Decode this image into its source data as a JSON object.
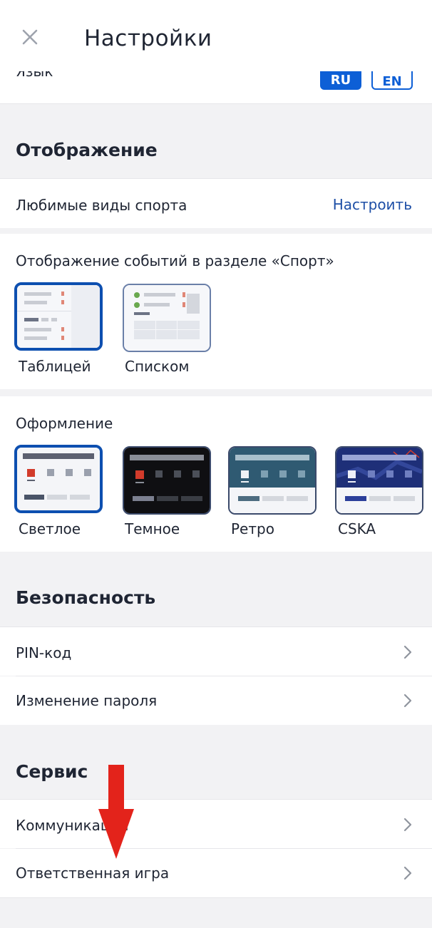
{
  "header": {
    "title": "Настройки"
  },
  "language": {
    "label": "Язык",
    "ru": "RU",
    "en": "EN"
  },
  "display": {
    "heading": "Отображение",
    "favorite_sports": {
      "label": "Любимые виды спорта",
      "action": "Настроить"
    },
    "events_view": {
      "label": "Отображение событий в разделе «Спорт»",
      "options": [
        "Таблицей",
        "Списком"
      ],
      "selected": "Таблицей"
    },
    "theme": {
      "label": "Оформление",
      "options": [
        "Светлое",
        "Темное",
        "Ретро",
        "CSKA"
      ],
      "selected": "Светлое"
    }
  },
  "security": {
    "heading": "Безопасность",
    "items": [
      "PIN-код",
      "Изменение пароля"
    ]
  },
  "service": {
    "heading": "Сервис",
    "items": [
      "Коммуникации",
      "Ответственная игра"
    ]
  },
  "colors": {
    "accent": "#0d5fd6",
    "link": "#1e4fa6",
    "annotation_arrow": "#e3231b"
  }
}
